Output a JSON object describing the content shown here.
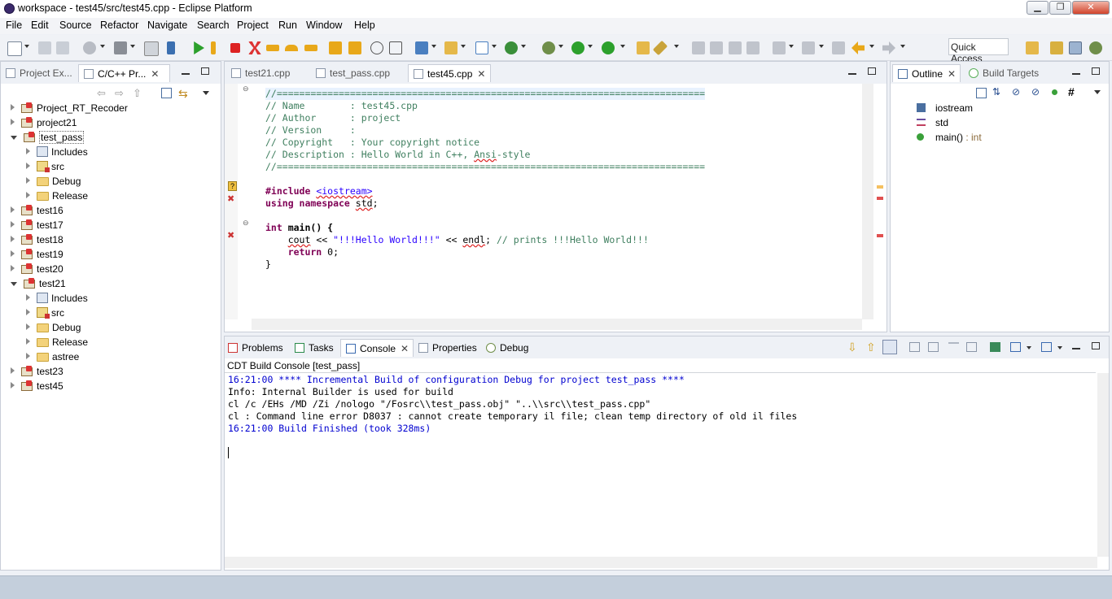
{
  "window": {
    "title": "workspace - test45/src/test45.cpp - Eclipse Platform",
    "minimize": "▁",
    "maximize": "❐",
    "close": "✕"
  },
  "menu": [
    "File",
    "Edit",
    "Source",
    "Refactor",
    "Navigate",
    "Search",
    "Project",
    "Run",
    "Window",
    "Help"
  ],
  "toolbar": {
    "quick_access": "Quick Access"
  },
  "left_panel": {
    "tabs": [
      {
        "label": "Project Ex..."
      },
      {
        "label": "C/C++ Pr..."
      }
    ],
    "tree": [
      {
        "label": "Project_RT_Recoder"
      },
      {
        "label": "project21"
      },
      {
        "label": "test_pass"
      },
      {
        "label": "Includes"
      },
      {
        "label": "src"
      },
      {
        "label": "Debug"
      },
      {
        "label": "Release"
      },
      {
        "label": "test16"
      },
      {
        "label": "test17"
      },
      {
        "label": "test18"
      },
      {
        "label": "test19"
      },
      {
        "label": "test20"
      },
      {
        "label": "test21"
      },
      {
        "label": "Includes"
      },
      {
        "label": "src"
      },
      {
        "label": "Debug"
      },
      {
        "label": "Release"
      },
      {
        "label": "astree"
      },
      {
        "label": "test23"
      },
      {
        "label": "test45"
      }
    ]
  },
  "editor": {
    "tabs": [
      {
        "label": "test21.cpp"
      },
      {
        "label": "test_pass.cpp"
      },
      {
        "label": "test45.cpp"
      }
    ],
    "lines": {
      "l1": "//============================================================================",
      "l2": "// Name        : test45.cpp",
      "l3": "// Author      : project",
      "l4": "// Version     :",
      "l5": "// Copyright   : Your copyright notice",
      "l6a": "// Description : Hello World in C++, ",
      "l6b": "Ansi",
      "l6c": "-style",
      "l7": "//============================================================================",
      "l9a": "#include",
      "l9b": "<iostream>",
      "l10a": "using namespace",
      "l10b": "std",
      "l10c": ";",
      "l12a": "int",
      "l12b": " main() {",
      "l13a": "    ",
      "l13b": "cout",
      "l13c": " << ",
      "l13d": "\"!!!Hello World!!!\"",
      "l13e": " << ",
      "l13f": "endl",
      "l13g": "; ",
      "l13h": "// prints !!!Hello World!!!",
      "l14a": "    return",
      "l14b": " 0;",
      "l15": "}"
    }
  },
  "outline": {
    "tabs": [
      {
        "label": "Outline"
      },
      {
        "label": "Build Targets"
      }
    ],
    "items": [
      {
        "label": "iostream",
        "type": ""
      },
      {
        "label": "std",
        "type": ""
      },
      {
        "label": "main()",
        "type": " : int"
      }
    ]
  },
  "bottom": {
    "tabs": [
      {
        "label": "Problems"
      },
      {
        "label": "Tasks"
      },
      {
        "label": "Console"
      },
      {
        "label": "Properties"
      },
      {
        "label": "Debug"
      }
    ],
    "console_title": "CDT Build Console [test_pass]",
    "console_lines": [
      "16:21:00 **** Incremental Build of configuration Debug for project test_pass ****",
      "Info: Internal Builder is used for build",
      "cl /c /EHs /MD /Zi /nologo \"/Fosrc\\\\test_pass.obj\" \"..\\\\src\\\\test_pass.cpp\"",
      "cl : Command line error D8037 : cannot create temporary il file; clean temp directory of old il files",
      "",
      "16:21:00 Build Finished (took 328ms)"
    ]
  },
  "colors": {
    "comment": "#3f7f5f",
    "keyword": "#7f0055",
    "string": "#2a00ff",
    "console_info": "#0000d0"
  }
}
